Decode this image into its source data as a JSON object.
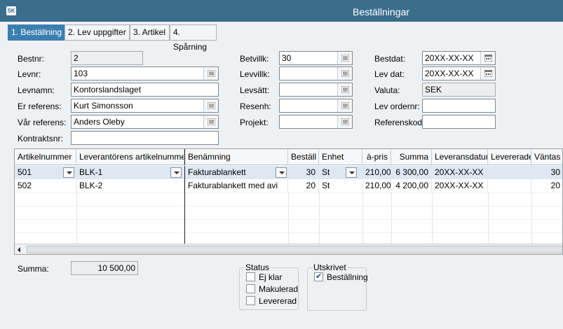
{
  "window": {
    "title": "Beställningar",
    "logo_text": "SK"
  },
  "tabs": [
    "1. Beställning",
    "2. Lev uppgifter",
    "3. Artikel",
    "4. Spårning"
  ],
  "form": {
    "bestnr_label": "Bestnr:",
    "bestnr": "2",
    "levnr_label": "Levnr:",
    "levnr": "103",
    "levnamn_label": "Levnamn:",
    "levnamn": "Kontorslandslaget",
    "er_ref_label": "Er referens:",
    "er_ref": "Kurt Simonsson",
    "var_ref_label": "Vår referens:",
    "var_ref": "Anders Oleby",
    "kontrakt_label": "Kontraktsnr:",
    "kontrakt": "",
    "betvillk_label": "Betvillk:",
    "betvillk": "30",
    "levvillk_label": "Levvillk:",
    "levvillk": "",
    "levsatt_label": "Levsätt:",
    "levsatt": "",
    "resenh_label": "Resenh:",
    "resenh": "",
    "projekt_label": "Projekt:",
    "projekt": "",
    "bestdat_label": "Bestdat:",
    "bestdat": "20XX-XX-XX",
    "levdat_label": "Lev dat:",
    "levdat": "20XX-XX-XX",
    "valuta_label": "Valuta:",
    "valuta": "SEK",
    "levordernr_label": "Lev ordernr:",
    "levordernr": "",
    "referenskod_label": "Referenskod:",
    "referenskod": ""
  },
  "grid": {
    "headers": [
      "Artikelnummer",
      "Leverantörens artikelnummer",
      "Benämning",
      "Beställ",
      "Enhet",
      "à-pris",
      "Summa",
      "Leveransdatum",
      "Levererade",
      "Väntas"
    ],
    "rows": [
      [
        "501",
        "BLK-1",
        "Fakturablankett",
        "30",
        "St",
        "210,00",
        "6 300,00",
        "20XX-XX-XX",
        "",
        "30"
      ],
      [
        "502",
        "BLK-2",
        "Fakturablankett med avi",
        "20",
        "St",
        "210,00",
        "4 200,00",
        "20XX-XX-XX",
        "",
        "20"
      ]
    ]
  },
  "summa": {
    "label": "Summa:",
    "value": "10 500,00"
  },
  "status": {
    "label": "Status",
    "items": [
      "Ej klar",
      "Makulerad",
      "Levererad"
    ]
  },
  "utskrivet": {
    "label": "Utskrivet",
    "items": [
      "Beställning"
    ]
  },
  "colors": {
    "titlebar": "#3a6e8c",
    "active_tab": "#3a7fb0",
    "selected_row": "#dde8f3"
  },
  "icons": {
    "lookup": "list-icon",
    "date": "calendar-icon",
    "dropdown": "chevron-down-icon",
    "scroll": "arrow-left-icon"
  }
}
